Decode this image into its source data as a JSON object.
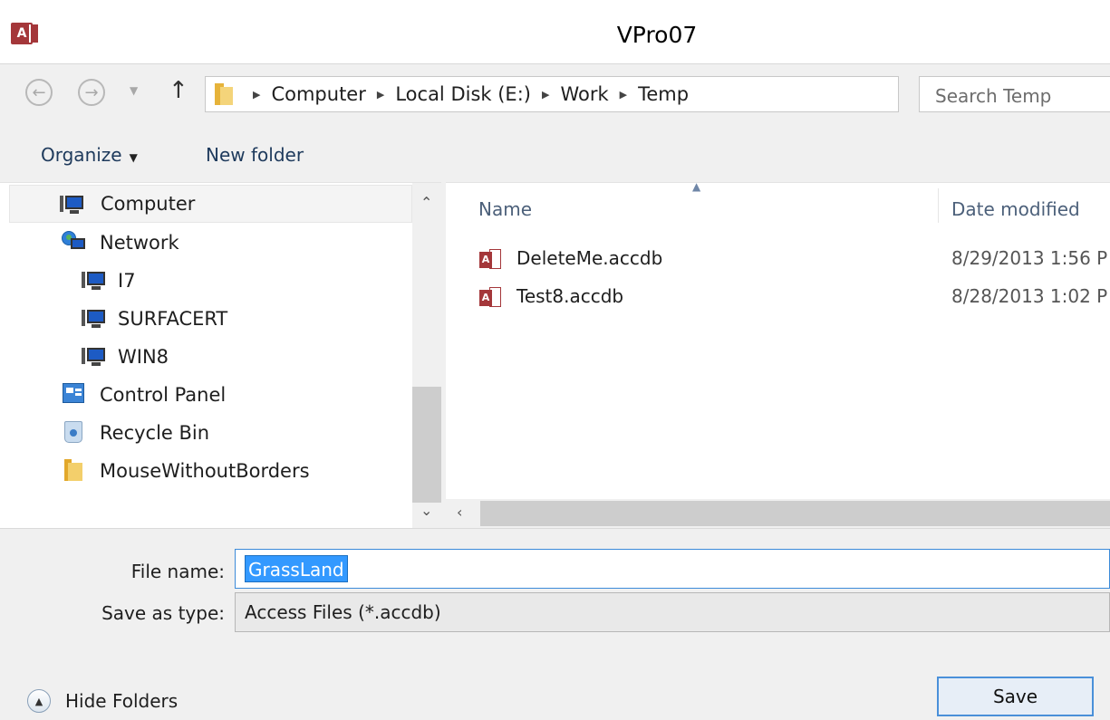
{
  "window": {
    "title": "VPro07",
    "app_icon_label": "A"
  },
  "address": {
    "breadcrumbs": [
      "Computer",
      "Local Disk (E:)",
      "Work",
      "Temp"
    ],
    "search_placeholder": "Search Temp"
  },
  "toolbar": {
    "organize_label": "Organize",
    "new_folder_label": "New folder"
  },
  "nav_pane": {
    "items": [
      {
        "label": "Computer",
        "icon": "computer-icon",
        "selected": true
      },
      {
        "label": "Network",
        "icon": "network-icon"
      },
      {
        "label": "I7",
        "icon": "computer-icon"
      },
      {
        "label": "SURFACERT",
        "icon": "computer-icon"
      },
      {
        "label": "WIN8",
        "icon": "computer-icon"
      },
      {
        "label": "Control Panel",
        "icon": "control-panel-icon"
      },
      {
        "label": "Recycle Bin",
        "icon": "recycle-bin-icon"
      },
      {
        "label": "MouseWithoutBorders",
        "icon": "folder-icon"
      }
    ]
  },
  "file_list": {
    "columns": [
      "Name",
      "Date modified"
    ],
    "files": [
      {
        "name": "DeleteMe.accdb",
        "date": "8/29/2013 1:56 P",
        "icon": "access-file-icon"
      },
      {
        "name": "Test8.accdb",
        "date": "8/28/2013 1:02 P",
        "icon": "access-file-icon"
      }
    ]
  },
  "form": {
    "file_name_label": "File name:",
    "file_name_value": "GrassLand",
    "save_type_label": "Save as type:",
    "save_type_value": "Access Files (*.accdb)",
    "hide_folders_label": "Hide Folders",
    "save_label": "Save"
  },
  "colors": {
    "access_red": "#a4373a",
    "selection_blue": "#3399ff",
    "focus_border": "#3c8bd9"
  }
}
